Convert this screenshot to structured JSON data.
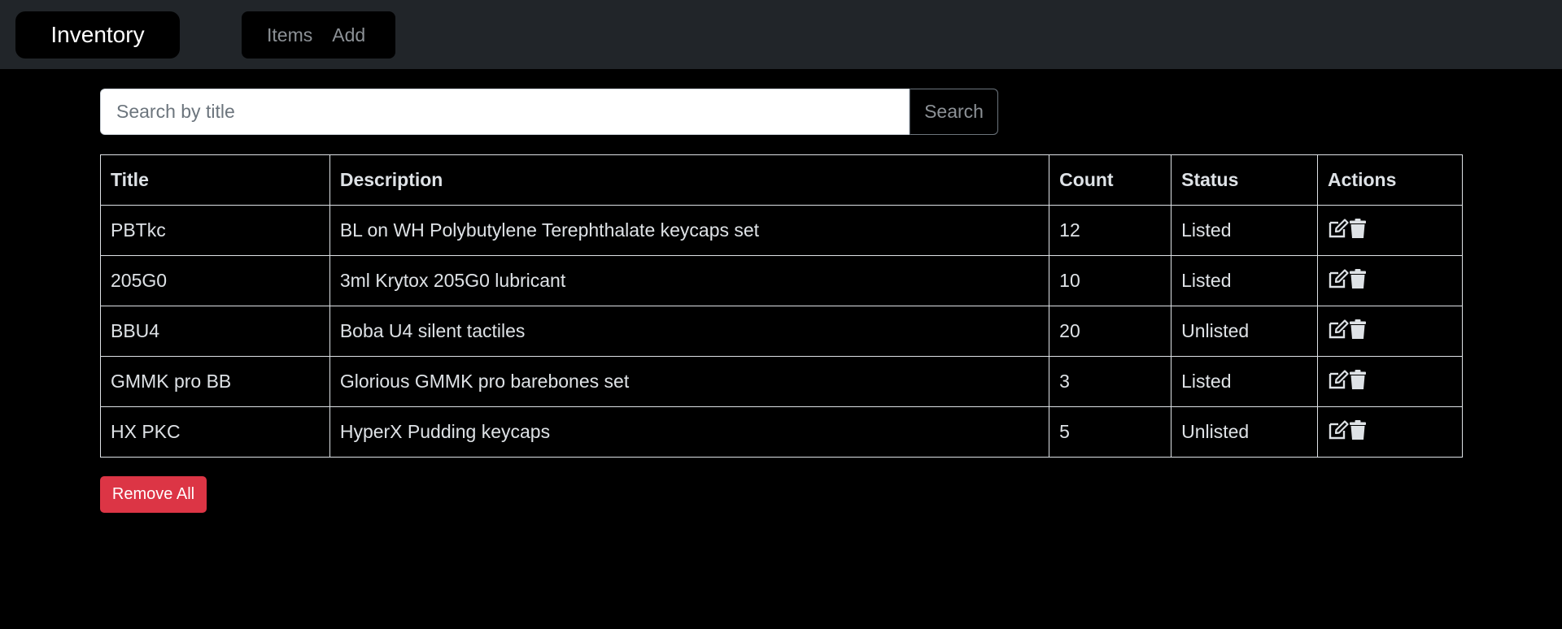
{
  "navbar": {
    "brand": "Inventory",
    "links": [
      {
        "label": "Items"
      },
      {
        "label": "Add"
      }
    ]
  },
  "search": {
    "placeholder": "Search by title",
    "value": "",
    "button_label": "Search"
  },
  "table": {
    "headers": {
      "title": "Title",
      "description": "Description",
      "count": "Count",
      "status": "Status",
      "actions": "Actions"
    },
    "rows": [
      {
        "title": "PBTkc",
        "description": "BL on WH Polybutylene Terephthalate keycaps set",
        "count": "12",
        "status": "Listed"
      },
      {
        "title": "205G0",
        "description": "3ml Krytox 205G0 lubricant",
        "count": "10",
        "status": "Listed"
      },
      {
        "title": "BBU4",
        "description": "Boba U4 silent tactiles",
        "count": "20",
        "status": "Unlisted"
      },
      {
        "title": "GMMK pro BB",
        "description": "Glorious GMMK pro barebones set",
        "count": "3",
        "status": "Listed"
      },
      {
        "title": "HX PKC",
        "description": "HyperX Pudding keycaps",
        "count": "5",
        "status": "Unlisted"
      }
    ],
    "row_action_icons": [
      "edit-icon",
      "trash-icon"
    ]
  },
  "remove_all_label": "Remove All",
  "colors": {
    "background": "#000000",
    "navbar": "#212529",
    "danger": "#dc3545",
    "text": "#dee2e6",
    "muted": "#8c9196"
  }
}
